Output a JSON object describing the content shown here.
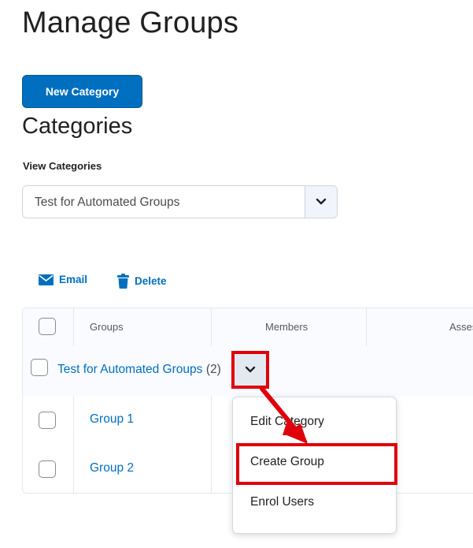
{
  "page": {
    "title": "Manage Groups",
    "new_category_label": "New Category",
    "section_title": "Categories",
    "view_label": "View Categories",
    "selected_category": "Test for Automated Groups"
  },
  "toolbar": {
    "email_label": "Email",
    "delete_label": "Delete"
  },
  "table": {
    "headers": [
      "Groups",
      "Members",
      "Asses"
    ],
    "category": {
      "name": "Test for Automated Groups",
      "count": "(2)"
    },
    "rows": [
      {
        "name": "Group 1"
      },
      {
        "name": "Group 2"
      }
    ]
  },
  "menu": {
    "items": [
      "Edit Category",
      "Create Group",
      "Enrol Users"
    ]
  },
  "colors": {
    "accent": "#006fbf",
    "highlight": "#e0000b"
  },
  "icons": [
    "email-icon",
    "trash-icon",
    "chevron-down-icon",
    "arrow-icon"
  ]
}
